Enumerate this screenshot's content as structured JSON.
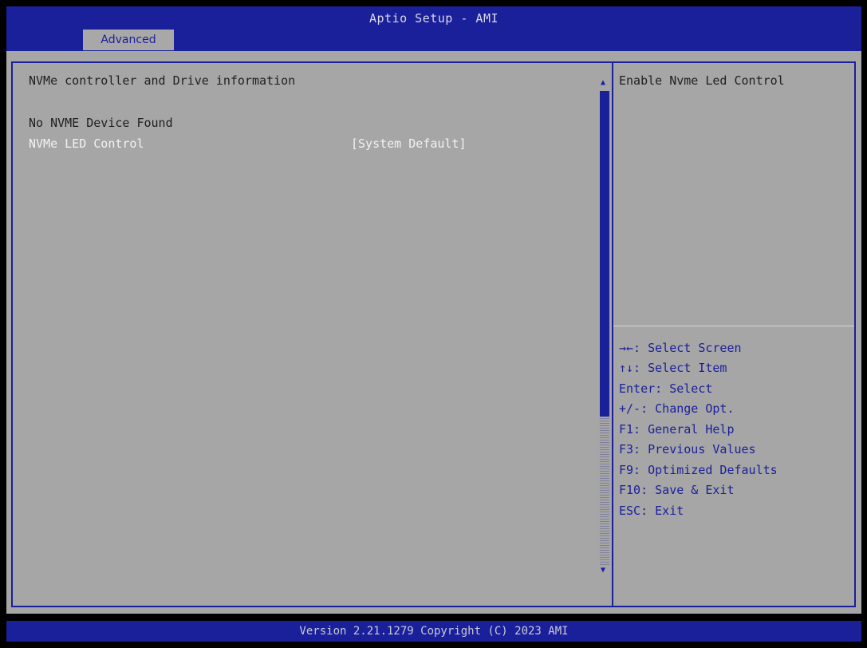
{
  "header": {
    "title": "Aptio Setup - AMI",
    "tab": "Advanced"
  },
  "content": {
    "heading": "NVMe controller and Drive information",
    "status": "No NVME Device Found",
    "option_label": "NVMe LED Control",
    "option_value": "[System Default]"
  },
  "help": {
    "description": "Enable Nvme Led Control",
    "keys": [
      "→←: Select Screen",
      "↑↓: Select Item",
      "Enter: Select",
      "+/-: Change Opt.",
      "F1: General Help",
      "F3: Previous Values",
      "F9: Optimized Defaults",
      "F10: Save & Exit",
      "ESC: Exit"
    ]
  },
  "footer": {
    "version": "Version 2.21.1279 Copyright (C) 2023 AMI"
  },
  "colors": {
    "header_blue": "#1a1f9a",
    "panel_gray": "#a6a6a6",
    "selected_text": "#f2f2f2"
  }
}
